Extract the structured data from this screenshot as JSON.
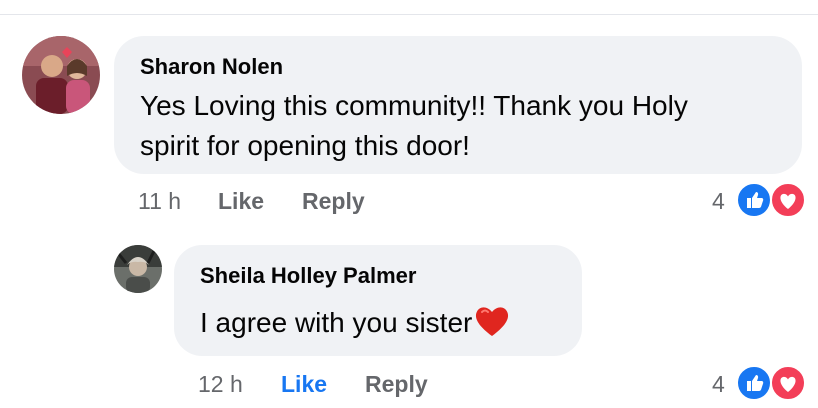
{
  "comments": [
    {
      "author": "Sharon Nolen",
      "text_line1": "Yes Loving this community!! Thank you Holy",
      "text_line2": "spirit for opening this door!",
      "time": "11 h",
      "like_label": "Like",
      "reply_label": "Reply",
      "reaction_count": "4",
      "liked": false,
      "reactions": [
        "like-icon",
        "love-icon"
      ]
    },
    {
      "author": "Sheila Holley Palmer",
      "text": "I agree with you sister",
      "emoji": "red-heart-icon",
      "time": "12 h",
      "like_label": "Like",
      "reply_label": "Reply",
      "reaction_count": "4",
      "liked": true,
      "reactions": [
        "like-icon",
        "love-icon"
      ]
    }
  ],
  "colors": {
    "bubble": "#f0f2f5",
    "meta_text": "#65676b",
    "like_active": "#1877f2",
    "love": "#f33e58"
  }
}
